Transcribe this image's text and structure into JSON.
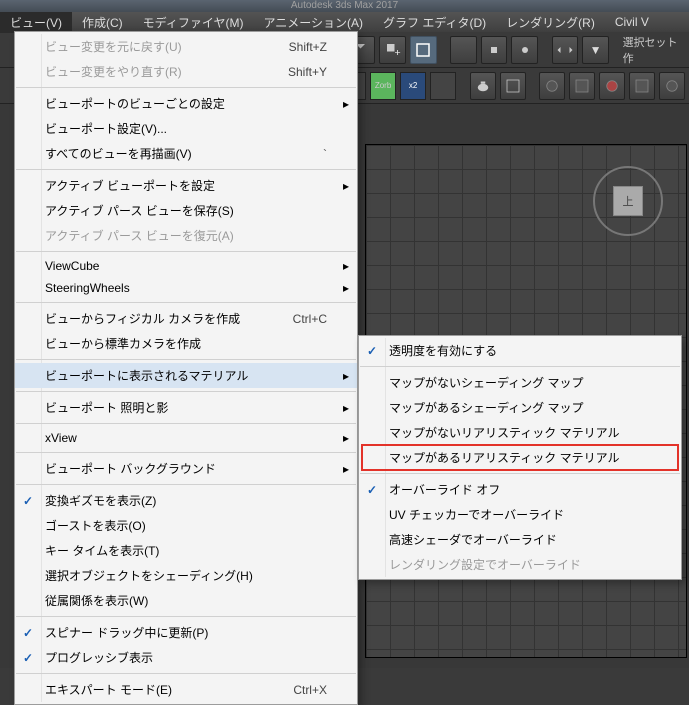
{
  "titlebar": "Autodesk 3ds Max 2017",
  "menubar": {
    "items": [
      "ビュー(V)",
      "作成(C)",
      "モディファイヤ(M)",
      "アニメーション(A)",
      "グラフ エディタ(D)",
      "レンダリング(R)",
      "Civil V"
    ]
  },
  "toolbar_select_label": "選択セット作",
  "viewcube_face": "上",
  "main_menu": [
    {
      "type": "item",
      "label": "ビュー変更を元に戻す(U)",
      "shortcut": "Shift+Z",
      "disabled": true
    },
    {
      "type": "item",
      "label": "ビュー変更をやり直す(R)",
      "shortcut": "Shift+Y",
      "disabled": true
    },
    {
      "type": "sep"
    },
    {
      "type": "item",
      "label": "ビューポートのビューごとの設定",
      "sub": true
    },
    {
      "type": "item",
      "label": "ビューポート設定(V)..."
    },
    {
      "type": "item",
      "label": "すべてのビューを再描画(V)",
      "shortcut": "`"
    },
    {
      "type": "sep"
    },
    {
      "type": "item",
      "label": "アクティブ ビューポートを設定",
      "sub": true
    },
    {
      "type": "item",
      "label": "アクティブ パース ビューを保存(S)"
    },
    {
      "type": "item",
      "label": "アクティブ パース ビューを復元(A)",
      "disabled": true
    },
    {
      "type": "sep"
    },
    {
      "type": "item",
      "label": "ViewCube",
      "sub": true
    },
    {
      "type": "item",
      "label": "SteeringWheels",
      "sub": true
    },
    {
      "type": "sep"
    },
    {
      "type": "item",
      "label": "ビューからフィジカル カメラを作成",
      "shortcut": "Ctrl+C"
    },
    {
      "type": "item",
      "label": "ビューから標準カメラを作成"
    },
    {
      "type": "sep"
    },
    {
      "type": "item",
      "label": "ビューポートに表示されるマテリアル",
      "sub": true,
      "highlight": true
    },
    {
      "type": "sep"
    },
    {
      "type": "item",
      "label": "ビューポート 照明と影",
      "sub": true
    },
    {
      "type": "sep"
    },
    {
      "type": "item",
      "label": "xView",
      "sub": true
    },
    {
      "type": "sep"
    },
    {
      "type": "item",
      "label": "ビューポート バックグラウンド",
      "sub": true
    },
    {
      "type": "sep"
    },
    {
      "type": "item",
      "label": "変換ギズモを表示(Z)",
      "checked": true
    },
    {
      "type": "item",
      "label": "ゴーストを表示(O)"
    },
    {
      "type": "item",
      "label": "キー タイムを表示(T)"
    },
    {
      "type": "item",
      "label": "選択オブジェクトをシェーディング(H)"
    },
    {
      "type": "item",
      "label": "従属関係を表示(W)"
    },
    {
      "type": "sep"
    },
    {
      "type": "item",
      "label": "スピナー ドラッグ中に更新(P)",
      "checked": true
    },
    {
      "type": "item",
      "label": "プログレッシブ表示",
      "checked": true
    },
    {
      "type": "sep"
    },
    {
      "type": "item",
      "label": "エキスパート モード(E)",
      "shortcut": "Ctrl+X"
    }
  ],
  "sub_menu": [
    {
      "type": "item",
      "label": "透明度を有効にする",
      "checked": true
    },
    {
      "type": "sep"
    },
    {
      "type": "item",
      "label": "マップがないシェーディング マップ"
    },
    {
      "type": "item",
      "label": "マップがあるシェーディング マップ"
    },
    {
      "type": "item",
      "label": "マップがないリアリスティック マテリアル"
    },
    {
      "type": "item",
      "label": "マップがあるリアリスティック マテリアル",
      "redbox": true
    },
    {
      "type": "sep"
    },
    {
      "type": "item",
      "label": "オーバーライド オフ",
      "checked": true
    },
    {
      "type": "item",
      "label": "UV チェッカーでオーバーライド"
    },
    {
      "type": "item",
      "label": "高速シェーダでオーバーライド"
    },
    {
      "type": "item",
      "label": "レンダリング設定でオーバーライド",
      "disabled": true
    }
  ]
}
